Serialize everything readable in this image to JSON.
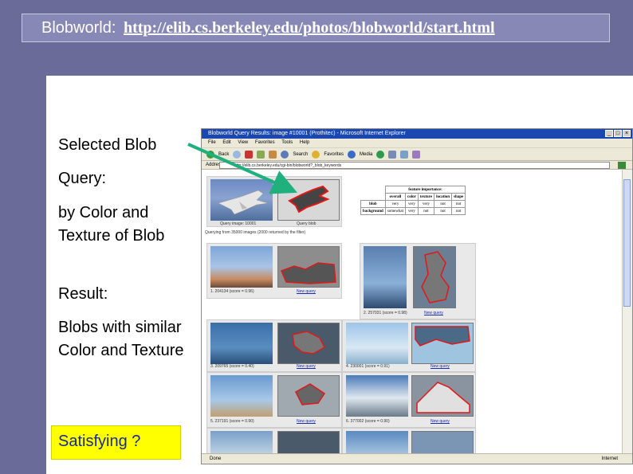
{
  "slide": {
    "title_label": "Blobworld:",
    "title_url": "http://elib.cs.berkeley.edu/photos/blobworld/start.html",
    "lines": [
      "Selected Blob",
      "Query:",
      "by Color and Texture of Blob",
      "Result:",
      "Blobs with similar Color and Texture"
    ],
    "callout": "Satisfying ?"
  },
  "colors": {
    "frame": "#6b6b9a",
    "arrow": "#1fb07e",
    "callout_bg": "#ffff00",
    "blob_outline": "#e01818"
  },
  "browser": {
    "title": "Blobworld Query Results: image #10001 (Prothitec) - Microsoft Internet Explorer",
    "menu": [
      "File",
      "Edit",
      "View",
      "Favorites",
      "Tools",
      "Help"
    ],
    "toolbar": [
      "Back",
      "Search",
      "Favorites",
      "Media"
    ],
    "address_label": "Address",
    "address_value": "http://elib.cs.berkeley.edu/cgi-bin/blobworld?_blob_keywords",
    "status_left": "Done",
    "status_zone": "Internet",
    "query": {
      "caption_image": "Query image: 10001",
      "caption_blob": "Query blob",
      "info": "Querying from 35000 images (2000 returned by the filter)"
    },
    "feature_table": {
      "title": "feature importance:",
      "headers": [
        "overall",
        "color",
        "texture",
        "location",
        "shape"
      ],
      "rows": [
        {
          "label": "blob",
          "cells": [
            "very",
            "very",
            "very",
            "not",
            "not"
          ]
        },
        {
          "label": "background",
          "cells": [
            "somewhat",
            "very",
            "not",
            "not",
            "not"
          ]
        }
      ]
    },
    "results": [
      {
        "caption": "1. 204134 (score = 0.96)",
        "link": "New query"
      },
      {
        "caption": "2. 257031 (score = 0.98)",
        "link": "New query"
      },
      {
        "caption": "3. 209765 (score = 0.40)",
        "link": "New query"
      },
      {
        "caption": "4. 230001 (score = 0.91)",
        "link": "New query"
      },
      {
        "caption": "5. 237191 (score = 0.90)",
        "link": "New query"
      },
      {
        "caption": "6. 377002 (score = 0.90)",
        "link": "New query"
      }
    ]
  }
}
